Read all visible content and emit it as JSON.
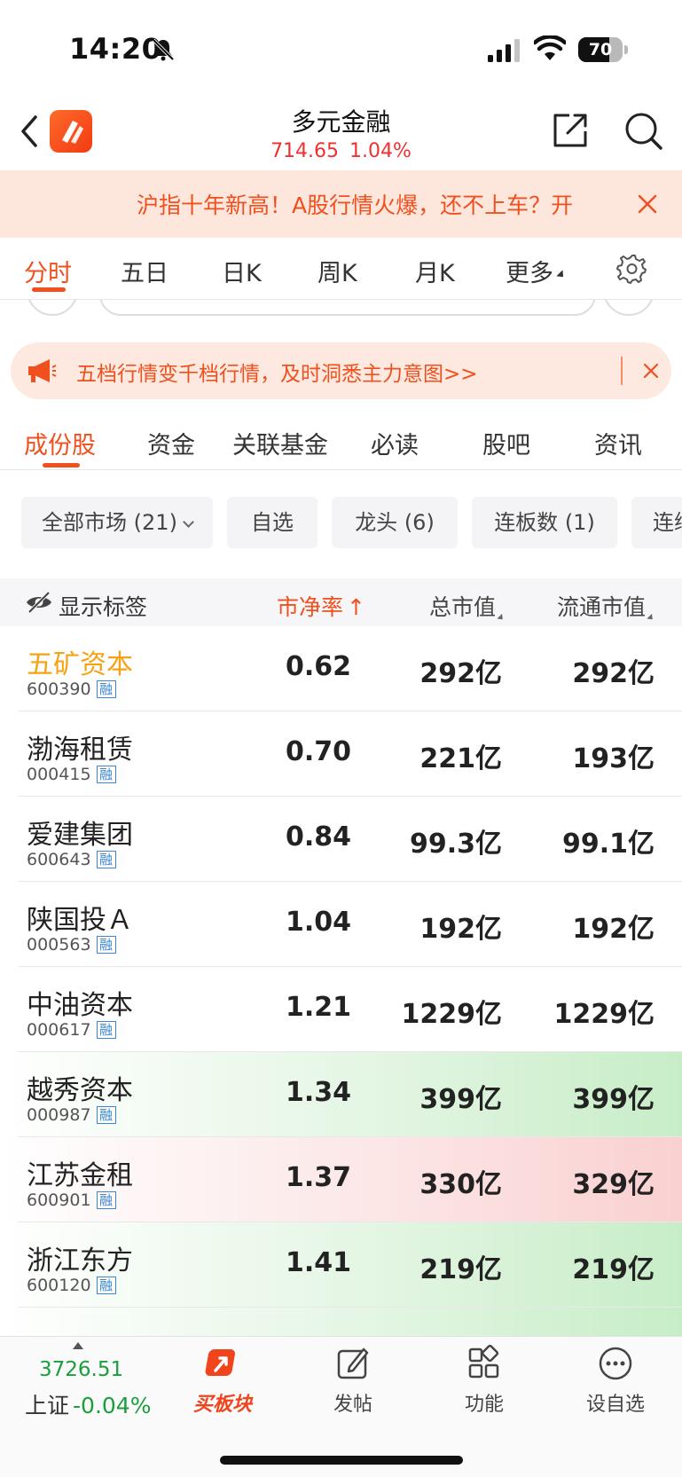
{
  "status": {
    "time": "14:20",
    "battery": "70",
    "battery_level": 0.7
  },
  "header": {
    "title": "多元金融",
    "price": "714.65",
    "change_pct": "1.04%"
  },
  "banner": {
    "text": "沪指十年新高！A股行情火爆，还不上车？开"
  },
  "chart_tabs": [
    {
      "label": "分时"
    },
    {
      "label": "五日"
    },
    {
      "label": "日K"
    },
    {
      "label": "周K"
    },
    {
      "label": "月K"
    },
    {
      "label": "更多"
    }
  ],
  "promo": {
    "text": "五档行情变千档行情，及时洞悉主力意图>>"
  },
  "section_tabs": [
    {
      "label": "成份股"
    },
    {
      "label": "资金"
    },
    {
      "label": "关联基金"
    },
    {
      "label": "必读"
    },
    {
      "label": "股吧"
    },
    {
      "label": "资讯"
    }
  ],
  "filters": [
    {
      "label": "全部市场 (21)"
    },
    {
      "label": "自选"
    },
    {
      "label": "龙头 (6)"
    },
    {
      "label": "连板数 (1)"
    },
    {
      "label": "连续"
    }
  ],
  "table": {
    "show_tags_label": "显示标签",
    "columns": {
      "pb": "市净率",
      "pb_arrow": "↑",
      "market_cap": "总市值",
      "float_cap": "流通市值"
    },
    "badge": "融",
    "rows": [
      {
        "name": "五矿资本",
        "code": "600390",
        "pb": "0.62",
        "mcap": "292亿",
        "float": "292亿"
      },
      {
        "name": "渤海租赁",
        "code": "000415",
        "pb": "0.70",
        "mcap": "221亿",
        "float": "193亿"
      },
      {
        "name": "爱建集团",
        "code": "600643",
        "pb": "0.84",
        "mcap": "99.3亿",
        "float": "99.1亿"
      },
      {
        "name": "陕国投Ａ",
        "code": "000563",
        "pb": "1.04",
        "mcap": "192亿",
        "float": "192亿"
      },
      {
        "name": "中油资本",
        "code": "000617",
        "pb": "1.21",
        "mcap": "1229亿",
        "float": "1229亿"
      },
      {
        "name": "越秀资本",
        "code": "000987",
        "pb": "1.34",
        "mcap": "399亿",
        "float": "399亿"
      },
      {
        "name": "江苏金租",
        "code": "600901",
        "pb": "1.37",
        "mcap": "330亿",
        "float": "329亿"
      },
      {
        "name": "浙江东方",
        "code": "600120",
        "pb": "1.41",
        "mcap": "219亿",
        "float": "219亿"
      }
    ]
  },
  "bottom_bar": {
    "index_value": "3726.51",
    "index_name": "上证",
    "index_change": "-0.04%",
    "items": [
      {
        "label": "买板块"
      },
      {
        "label": "发帖"
      },
      {
        "label": "功能"
      },
      {
        "label": "设自选"
      }
    ]
  },
  "colors": {
    "accent": "#f0501e",
    "up": "#f03030",
    "down": "#1b9e3e",
    "highlight": "#f5a214",
    "badge": "#3a86d4"
  }
}
